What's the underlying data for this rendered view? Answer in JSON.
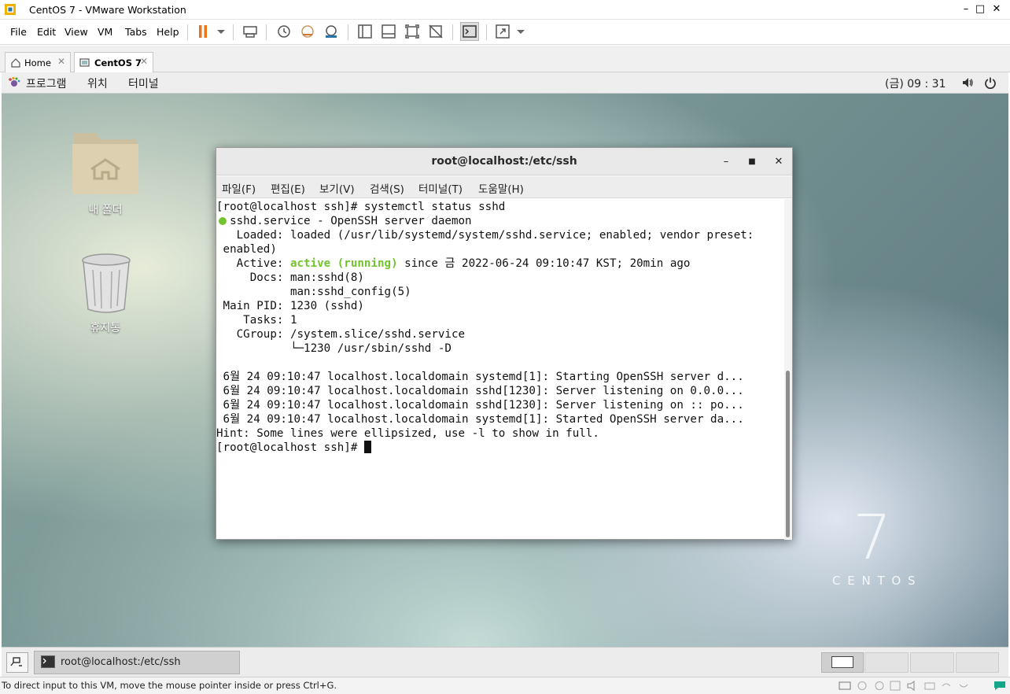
{
  "window": {
    "title": "CentOS 7 - VMware Workstation",
    "min": "–",
    "max": "□",
    "close": "✕"
  },
  "menubar": {
    "file": "File",
    "edit": "Edit",
    "view": "View",
    "vm": "VM",
    "tabs": "Tabs",
    "help": "Help"
  },
  "tabs": [
    {
      "label": "Home"
    },
    {
      "label": "CentOS 7"
    }
  ],
  "gnome": {
    "applications": "프로그램",
    "places": "위치",
    "terminal": "터미널",
    "clock": "(금) 09 : 31"
  },
  "desktop": {
    "folder_label": "내 폴더",
    "trash_label": "휴지통",
    "brand_number": "7",
    "brand_name": "C E N T O S"
  },
  "terminal": {
    "title": "root@localhost:/etc/ssh",
    "menu": [
      "파일(F)",
      "편집(E)",
      "보기(V)",
      "검색(S)",
      "터미널(T)",
      "도움말(H)"
    ],
    "lines": [
      "[root@localhost ssh]# systemctl status sshd",
      "  sshd.service - OpenSSH server daemon",
      "   Loaded: loaded (/usr/lib/systemd/system/sshd.service; enabled; vendor preset:",
      " enabled)",
      "   Active: ",
      "     Docs: man:sshd(8)",
      "           man:sshd_config(5)",
      " Main PID: 1230 (sshd)",
      "    Tasks: 1",
      "   CGroup: /system.slice/sshd.service",
      "           └─1230 /usr/sbin/sshd -D",
      "",
      " 6월 24 09:10:47 localhost.localdomain systemd[1]: Starting OpenSSH server d...",
      " 6월 24 09:10:47 localhost.localdomain sshd[1230]: Server listening on 0.0.0...",
      " 6월 24 09:10:47 localhost.localdomain sshd[1230]: Server listening on :: po...",
      " 6월 24 09:10:47 localhost.localdomain systemd[1]: Started OpenSSH server da...",
      "Hint: Some lines were ellipsized, use -l to show in full.",
      "[root@localhost ssh]# "
    ],
    "active_status": "active (running)",
    "active_rest": " since 금 2022-06-24 09:10:47 KST; 20min ago",
    "status_color": "#73c32f"
  },
  "taskbar": {
    "window_label": "root@localhost:/etc/ssh"
  },
  "statusbar": {
    "message": "To direct input to this VM, move the mouse pointer inside or press Ctrl+G."
  },
  "colors": {
    "pause": "#e8731d",
    "accent_teal": "#14a68a"
  }
}
